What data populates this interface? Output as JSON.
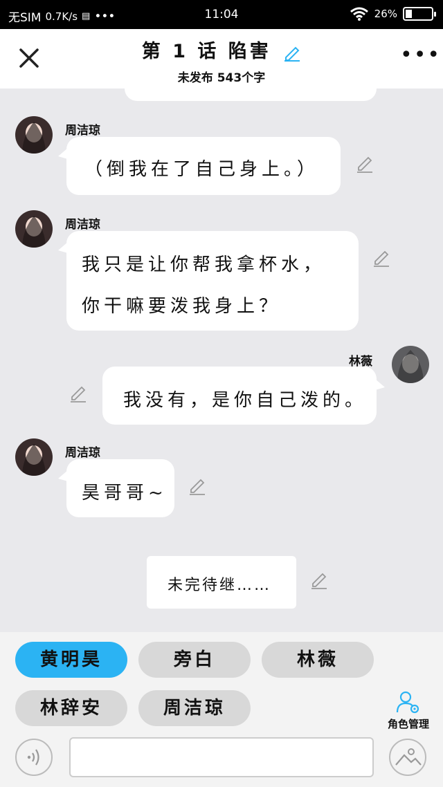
{
  "status_bar": {
    "carrier": "无SIM",
    "speed": "0.7K/s",
    "time": "11:04",
    "battery": "26%",
    "battery_level": 0.26
  },
  "header": {
    "title": "第 1 话 陷害",
    "subtitle": "未发布 543个字",
    "close_icon": "close-icon",
    "more_icon": "more-icon",
    "edit_icon": "pencil-icon"
  },
  "messages": [
    {
      "side": "left",
      "speaker": "周洁琼",
      "lines": [
        "（倒我在了自己身上。）"
      ]
    },
    {
      "side": "left",
      "speaker": "周洁琼",
      "lines": [
        "我只是让你帮我拿杯水，",
        "你干嘛要泼我身上？"
      ]
    },
    {
      "side": "right",
      "speaker": "林薇",
      "lines": [
        "我没有，是你自己泼的。"
      ]
    },
    {
      "side": "left",
      "speaker": "周洁琼",
      "lines": [
        "昊哥哥~"
      ]
    }
  ],
  "to_be_continued": "未完待继……",
  "roles": [
    {
      "label": "黄明昊",
      "active": true
    },
    {
      "label": "旁白",
      "active": false
    },
    {
      "label": "林薇",
      "active": false
    },
    {
      "label": "林辞安",
      "active": false
    },
    {
      "label": "周洁琼",
      "active": false
    }
  ],
  "role_manage_label": "角色管理",
  "input": {
    "value": "",
    "placeholder": ""
  },
  "colors": {
    "accent": "#2bb3f3",
    "chip": "#d8d8d8",
    "background": "#e9e9ec"
  }
}
